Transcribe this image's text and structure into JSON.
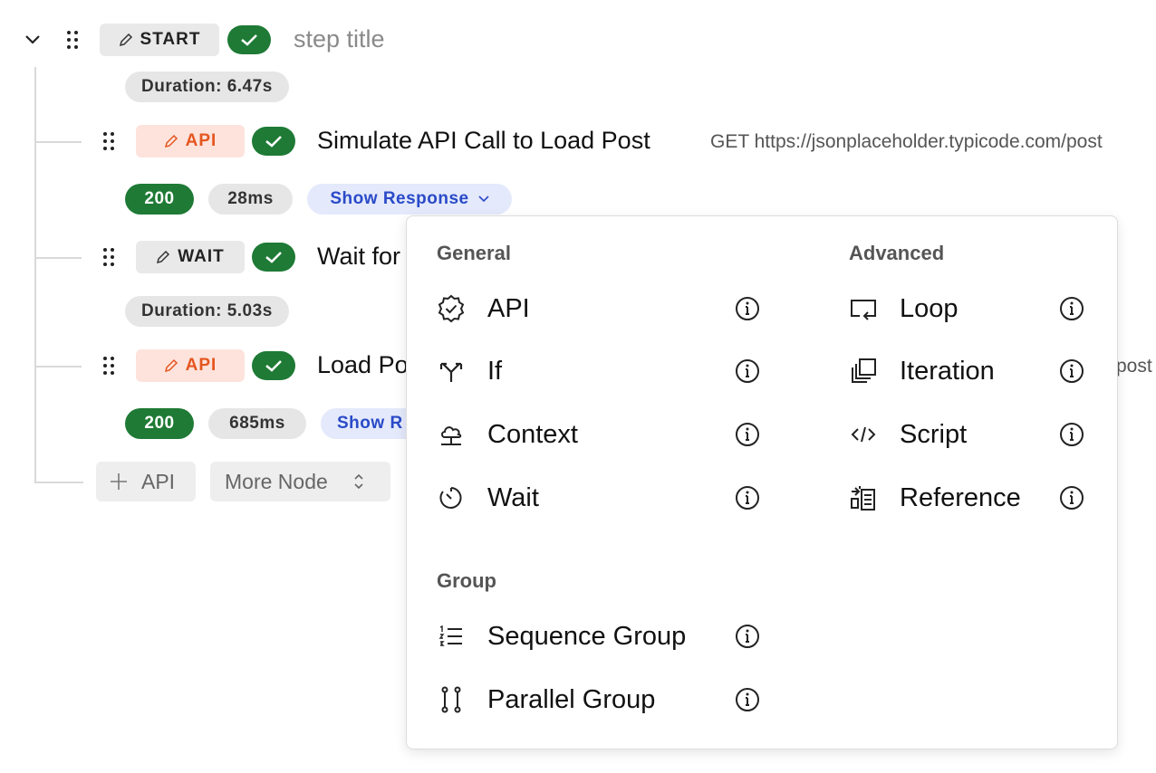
{
  "flow": {
    "start": {
      "tag": "START",
      "title": "step title",
      "duration": "Duration: 6.47s"
    },
    "step1": {
      "tag": "API",
      "title": "Simulate API Call to Load Post",
      "url": "GET https://jsonplaceholder.typicode.com/post",
      "status": "200",
      "time": "28ms",
      "show_response": "Show Response"
    },
    "step2": {
      "tag": "WAIT",
      "title": "Wait for",
      "duration": "Duration: 5.03s"
    },
    "step3": {
      "tag": "API",
      "title": "Load Po",
      "url_tail": "post",
      "status": "200",
      "time": "685ms",
      "show_response": "Show R"
    },
    "add_api": "API",
    "more_node": "More Node"
  },
  "menu": {
    "general_heading": "General",
    "advanced_heading": "Advanced",
    "group_heading": "Group",
    "general": [
      {
        "label": "API",
        "icon": "badge-check-icon"
      },
      {
        "label": "If",
        "icon": "split-icon"
      },
      {
        "label": "Context",
        "icon": "cloud-upload-icon"
      },
      {
        "label": "Wait",
        "icon": "timer-icon"
      }
    ],
    "advanced": [
      {
        "label": "Loop",
        "icon": "loop-icon"
      },
      {
        "label": "Iteration",
        "icon": "copy-stack-icon"
      },
      {
        "label": "Script",
        "icon": "code-icon"
      },
      {
        "label": "Reference",
        "icon": "reference-icon"
      }
    ],
    "group": [
      {
        "label": "Sequence Group",
        "icon": "ordered-list-icon"
      },
      {
        "label": "Parallel Group",
        "icon": "parallel-icon"
      }
    ]
  },
  "colors": {
    "success": "#1e7a35",
    "api_tag_bg": "#fde3dc",
    "api_tag_text": "#e5561f",
    "link_blue": "#2a4ac8"
  }
}
